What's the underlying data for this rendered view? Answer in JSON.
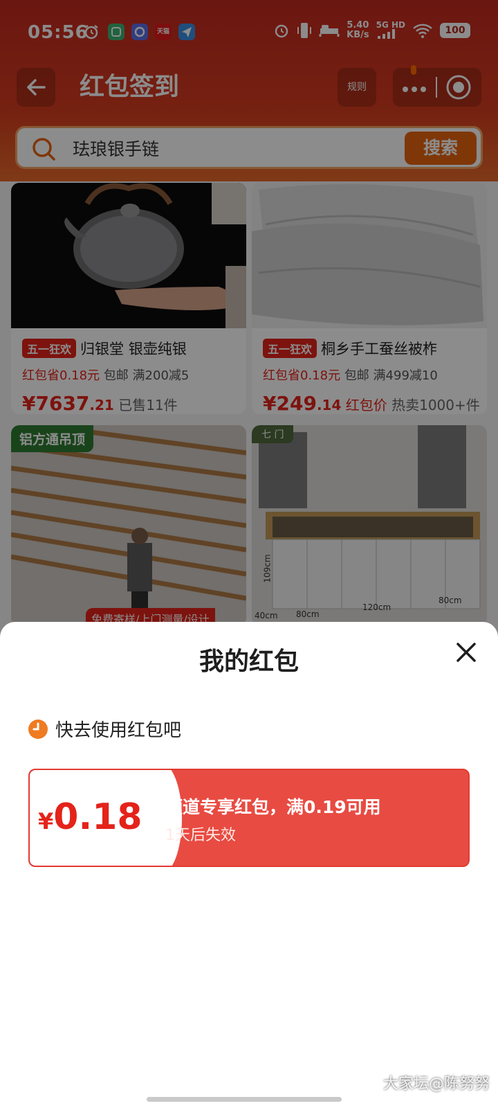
{
  "status_bar": {
    "time": "05:56",
    "speed_value": "5.40",
    "speed_unit": "KB/s",
    "network": "5G HD",
    "battery": "100",
    "app_icons": [
      "alarm-icon",
      "app-green-icon",
      "app-blue-icon",
      "tmall-icon",
      "send-icon"
    ],
    "tmall_label": "天猫"
  },
  "nav": {
    "title": "红包签到",
    "rules_label": "规则"
  },
  "search": {
    "value": "珐琅银手链",
    "button_label": "搜索"
  },
  "products": [
    {
      "tag": "五一狂欢",
      "title": "归银堂 银壶纯银",
      "promo_red": "红包省0.18元",
      "promo_rest": "包邮 满200减5",
      "price_int": "¥7637",
      "price_dec": ".21",
      "sub": "已售11件",
      "sub_red": ""
    },
    {
      "tag": "五一狂欢",
      "title": "桐乡手工蚕丝被柞",
      "promo_red": "红包省0.18元",
      "promo_rest": "包邮 满499减10",
      "price_int": "¥249",
      "price_dec": ".14",
      "sub": "热卖1000+件",
      "sub_red": "红包价"
    },
    {
      "overlay_tag": "铝方通吊顶",
      "banner": "免费寄样/上门测量/设计"
    },
    {
      "overlay_tag": "七 门",
      "dims": [
        "109cm",
        "80cm",
        "120cm",
        "80cm",
        "40cm"
      ]
    }
  ],
  "sheet": {
    "title": "我的红包",
    "tip": "快去使用红包吧",
    "coupon": {
      "currency": "¥",
      "amount": "0.18",
      "description": "频道专享红包，满0.19可用",
      "expiry": "1天后失效"
    }
  },
  "watermark": "大家坛@陈努努",
  "colors": {
    "header_red": "#c32a20",
    "accent_orange": "#e8650f",
    "coupon_red": "#e84b42",
    "price_red": "#e4231a"
  }
}
